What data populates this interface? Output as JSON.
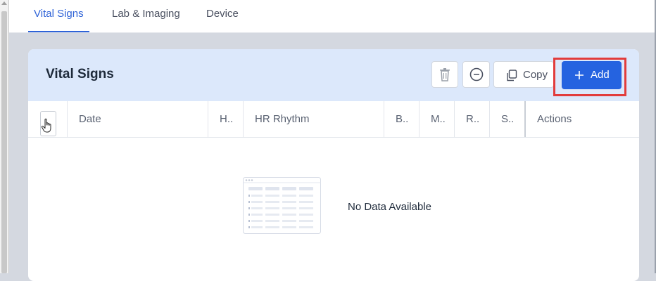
{
  "tabs": [
    {
      "label": "Vital Signs",
      "active": true
    },
    {
      "label": "Lab & Imaging",
      "active": false
    },
    {
      "label": "Device",
      "active": false
    }
  ],
  "card": {
    "title": "Vital Signs",
    "toolbar": {
      "delete_icon": "trash-icon",
      "remove_icon": "minus-circle-icon",
      "copy_label": "Copy",
      "add_label": "Add"
    }
  },
  "table": {
    "columns": [
      "Date",
      "H..",
      "HR Rhythm",
      "B..",
      "M..",
      "R..",
      "S..",
      "Actions"
    ],
    "empty_text": "No Data Available"
  },
  "colors": {
    "accent": "#2563e0",
    "header_bg": "#dce8fb",
    "highlight": "#e23c3c",
    "page_bg": "#d4d8e0"
  }
}
